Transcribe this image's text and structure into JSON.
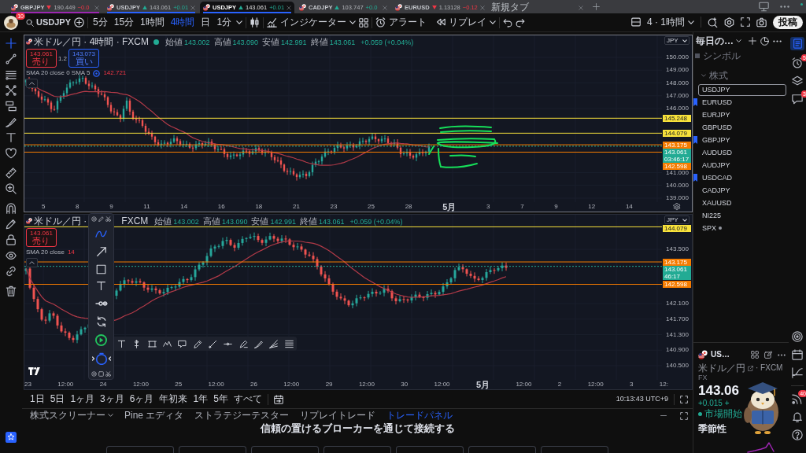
{
  "browser_tabs": [
    {
      "symbol": "GBPJPY",
      "kind": "down",
      "price": "190.449",
      "change": "−0.0",
      "selected": false,
      "color": "#9c27b0"
    },
    {
      "symbol": "USDJPY",
      "kind": "up",
      "price": "143.061",
      "change": "+0.01",
      "selected": false,
      "color": "#2962ff"
    },
    {
      "symbol": "USDJPY",
      "kind": "up",
      "price": "143.061",
      "change": "+0.01",
      "selected": true,
      "color": "#2962ff"
    },
    {
      "symbol": "CADJPY",
      "kind": "up",
      "price": "103.747",
      "change": "+0.0",
      "selected": false
    },
    {
      "symbol": "EURUSD",
      "kind": "down",
      "price": "1.13128",
      "change": "−0.12",
      "selected": false
    }
  ],
  "new_tab": "新規タブ",
  "toolbar": {
    "avatar_badge": "10",
    "symbol": "USDJPY",
    "intervals": [
      {
        "label": "5分",
        "selected": false
      },
      {
        "label": "15分",
        "selected": false
      },
      {
        "label": "1時間",
        "selected": false
      },
      {
        "label": "4時間",
        "selected": true
      },
      {
        "label": "日",
        "selected": false
      },
      {
        "label": "1分",
        "selected": false
      }
    ],
    "indicators": "インジケーター",
    "alert": "アラート",
    "replay": "リプレイ",
    "layout": "4 · 1時間",
    "publish": "投稿"
  },
  "left_tools": [
    {
      "selected": true
    },
    {
      "selected": false
    },
    {
      "selected": false
    },
    {
      "selected": false
    },
    {
      "selected": false
    },
    {
      "selected": false
    },
    {
      "selected": false
    },
    {
      "selected": false
    },
    {
      "selected": false
    },
    {
      "selected": false
    },
    {
      "selected": false
    },
    {
      "selected": false
    },
    {
      "selected": false
    },
    {
      "selected": false
    },
    {
      "selected": false
    },
    {
      "selected": false
    }
  ],
  "charts": [
    {
      "selected": true,
      "title_parts": [
        "米ドル／円 · 4時間 · FXCM"
      ],
      "status_dot": true,
      "ohlc": [
        {
          "label": "始値",
          "value": "143.002"
        },
        {
          "label": "高値",
          "value": "143.090"
        },
        {
          "label": "安値",
          "value": "142.991"
        },
        {
          "label": "終値",
          "value": "143.061"
        }
      ],
      "change": "+0.059 (+0.04%)",
      "sell": {
        "price": "143.061",
        "label": "売り"
      },
      "spread": "1.2",
      "buy": {
        "price": "143.073",
        "label": "買い"
      },
      "indicator": {
        "name": "SMA 20 close 0 SMA 5",
        "status_icon": true,
        "value": "142.721"
      },
      "currency": "JPY",
      "price_ticks": [
        "150.000",
        "149.000",
        "148.000",
        "147.000",
        "146.000",
        "141.000",
        "140.000",
        "139.000"
      ],
      "price_markers": [
        {
          "price": "145.248",
          "kind": "level",
          "color": "#f7e13b"
        },
        {
          "price": "144.079",
          "kind": "level",
          "color": "#f7e13b"
        },
        {
          "price": "143.175",
          "kind": "level",
          "color": "#f57c00"
        },
        {
          "price": "143.061",
          "kind": "last",
          "countdown": "03:46:17",
          "color": "#22ab94"
        },
        {
          "price": "142.598",
          "kind": "level",
          "color": "#f57c00"
        }
      ],
      "time_ticks": [
        {
          "label": "5",
          "major": false
        },
        {
          "label": "8",
          "major": false
        },
        {
          "label": "9",
          "major": false
        },
        {
          "label": "11",
          "major": false
        },
        {
          "label": "14",
          "major": false
        },
        {
          "label": "16",
          "major": false
        },
        {
          "label": "18",
          "major": false
        },
        {
          "label": "21",
          "major": false
        },
        {
          "label": "23",
          "major": false
        },
        {
          "label": "25",
          "major": false
        },
        {
          "label": "28",
          "major": false
        },
        {
          "label": "5月",
          "major": true
        },
        {
          "label": "3",
          "major": false
        },
        {
          "label": "7",
          "major": false
        },
        {
          "label": "9",
          "major": false
        },
        {
          "label": "12",
          "major": false
        },
        {
          "label": "14",
          "major": false
        }
      ]
    },
    {
      "selected": false,
      "title_parts": [
        "米ドル／円 ·",
        "FXCM"
      ],
      "status_dot": false,
      "ohlc": [
        {
          "label": "始値",
          "value": "143.002"
        },
        {
          "label": "高値",
          "value": "143.090"
        },
        {
          "label": "安値",
          "value": "142.991"
        },
        {
          "label": "終値",
          "value": "143.061"
        }
      ],
      "change": "+0.059 (+0.04%)",
      "sell": {
        "price": "143.061",
        "label": "売り"
      },
      "indicator": {
        "name": "SMA 20 close",
        "status_icon": false,
        "value": "14"
      },
      "currency": "JPY",
      "price_ticks": [
        "143.500",
        "142.100",
        "141.700",
        "141.300",
        "140.900",
        "140.500"
      ],
      "price_markers": [
        {
          "price": "144.079",
          "kind": "level",
          "color": "#f7e13b"
        },
        {
          "price": "143.175",
          "kind": "level",
          "color": "#f57c00"
        },
        {
          "price": "143.061",
          "kind": "last",
          "countdown": "46:17",
          "color": "#22ab94"
        },
        {
          "price": "142.598",
          "kind": "level",
          "color": "#f57c00"
        }
      ],
      "time_ticks": [
        {
          "label": "23",
          "major": false
        },
        {
          "label": "12:00",
          "major": false
        },
        {
          "label": "24",
          "major": false
        },
        {
          "label": "12:00",
          "major": false
        },
        {
          "label": "25",
          "major": false
        },
        {
          "label": "12:00",
          "major": false
        },
        {
          "label": "26",
          "major": false
        },
        {
          "label": "12:00",
          "major": false
        },
        {
          "label": "29",
          "major": false
        },
        {
          "label": "12:00",
          "major": false
        },
        {
          "label": "30",
          "major": false
        },
        {
          "label": "12:00",
          "major": false
        },
        {
          "label": "5月",
          "major": true
        },
        {
          "label": "12:00",
          "major": false
        },
        {
          "label": "2",
          "major": false
        },
        {
          "label": "12:00",
          "major": false
        },
        {
          "label": "3",
          "major": false
        },
        {
          "label": "12:",
          "major": false
        }
      ]
    }
  ],
  "range_bar": {
    "ranges": [
      "1日",
      "5日",
      "1ヶ月",
      "3ヶ月",
      "6ヶ月",
      "年初来",
      "1年",
      "5年",
      "すべて"
    ],
    "clock": "10:13:43 UTC+9"
  },
  "bottom_panel": {
    "tabs": [
      {
        "label": "株式スクリーナー",
        "dropdown": true,
        "selected": false
      },
      {
        "label": "Pine エディタ",
        "dropdown": false,
        "selected": false
      },
      {
        "label": "ストラテジーテスター",
        "dropdown": false,
        "selected": false
      },
      {
        "label": "リプレイトレード",
        "dropdown": false,
        "selected": false
      },
      {
        "label": "トレードパネル",
        "dropdown": false,
        "selected": true
      }
    ],
    "headline": "信頼の置けるブローカーを通じて接続する"
  },
  "watchlist": {
    "title": "毎日の…",
    "column": "シンボル",
    "section": "株式",
    "items": [
      {
        "symbol": "USDJPY",
        "flagged": false,
        "selected": true,
        "dot": false
      },
      {
        "symbol": "EURUSD",
        "flagged": true,
        "selected": false,
        "dot": false
      },
      {
        "symbol": "EURJPY",
        "flagged": false,
        "selected": false,
        "dot": false
      },
      {
        "symbol": "GBPUSD",
        "flagged": false,
        "selected": false,
        "dot": false
      },
      {
        "symbol": "GBPJPY",
        "flagged": true,
        "selected": false,
        "dot": false
      },
      {
        "symbol": "AUDUSD",
        "flagged": false,
        "selected": false,
        "dot": false
      },
      {
        "symbol": "AUDJPY",
        "flagged": false,
        "selected": false,
        "dot": false
      },
      {
        "symbol": "USDCAD",
        "flagged": true,
        "selected": false,
        "dot": false
      },
      {
        "symbol": "CADJPY",
        "flagged": false,
        "selected": false,
        "dot": false
      },
      {
        "symbol": "XAUUSD",
        "flagged": false,
        "selected": false,
        "dot": false
      },
      {
        "symbol": "NI225",
        "flagged": false,
        "selected": false,
        "dot": false
      },
      {
        "symbol": "SPX",
        "flagged": false,
        "selected": false,
        "dot": true
      }
    ]
  },
  "symbol_details": {
    "symbol": "US…",
    "name": "米ドル／円",
    "exchange": "· FXCM",
    "type": "FX",
    "price": "143.06",
    "change": "+0.015 +",
    "status": "市場開始",
    "section": "季節性"
  },
  "right_bar": {
    "watchlist_selected": true,
    "alerts_badge": "5",
    "chat_badge": "3",
    "news_badge": "40"
  }
}
